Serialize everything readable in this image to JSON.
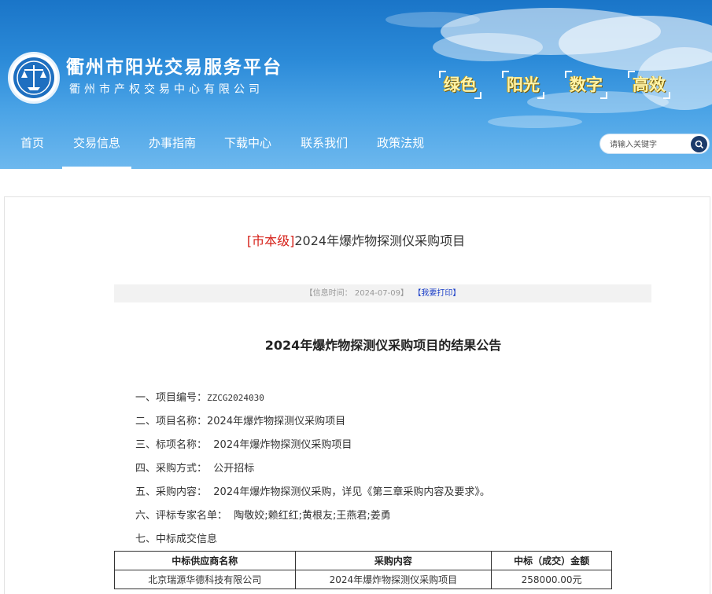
{
  "header": {
    "site_title": "衢州市阳光交易服务平台",
    "site_subtitle": "衢州市产权交易中心有限公司",
    "slogans": [
      "绿色",
      "阳光",
      "数字",
      "高效"
    ]
  },
  "nav": {
    "items": [
      "首页",
      "交易信息",
      "办事指南",
      "下载中心",
      "联系我们",
      "政策法规"
    ],
    "active": "交易信息"
  },
  "search": {
    "placeholder": "请输入关键字"
  },
  "article": {
    "tag": "[市本级]",
    "title": "2024年爆炸物探测仪采购项目",
    "meta_label": "【信息时间：",
    "meta_date": "2024-07-09",
    "meta_close": "】",
    "print_label": "【我要打印】"
  },
  "doc": {
    "title": "2024年爆炸物探测仪采购项目的结果公告",
    "items": [
      {
        "label": "一、项目编号：",
        "value": "ZZCG2024030"
      },
      {
        "label": "二、项目名称：",
        "value": "2024年爆炸物探测仪采购项目"
      },
      {
        "label": "三、标项名称：",
        "value": "  2024年爆炸物探测仪采购项目"
      },
      {
        "label": "四、采购方式：",
        "value": "  公开招标"
      },
      {
        "label": "五、采购内容：",
        "value": "  2024年爆炸物探测仪采购，详见《第三章采购内容及要求》。"
      },
      {
        "label": "六、评标专家名单：",
        "value": "  陶敬姣;赖红红;黄根友;王燕君;姜勇"
      },
      {
        "label": "七、中标成交信息",
        "value": ""
      }
    ],
    "table": {
      "headers": [
        "中标供应商名称",
        "采购内容",
        "中标（成交）金额"
      ],
      "rows": [
        [
          "北京瑞源华德科技有限公司",
          "2024年爆炸物探测仪采购项目",
          "258000.00元"
        ]
      ]
    }
  },
  "colors": {
    "header_blue": "#1a75c8",
    "tag_red": "#d6221a",
    "print_blue": "#1a3ec8"
  }
}
